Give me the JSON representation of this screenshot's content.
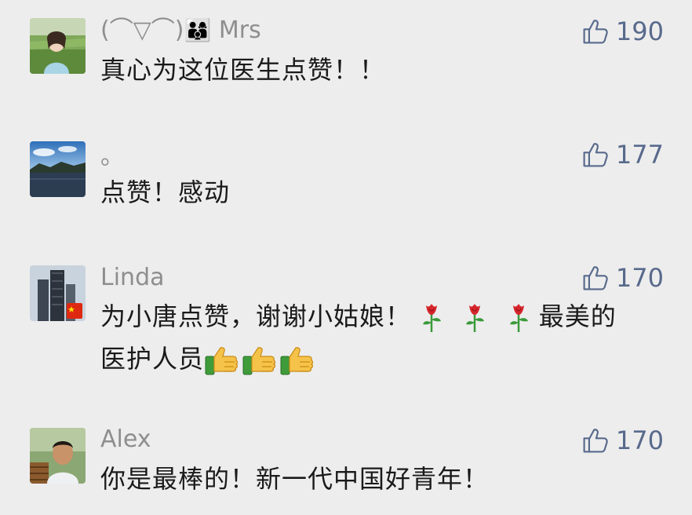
{
  "comments": [
    {
      "name": "(⌒▽⌒)",
      "name_emoji": "👨‍👩‍👦",
      "name_suffix": "Mrs",
      "likes": "190",
      "text": "真心为这位医生点赞！！"
    },
    {
      "name": "。",
      "likes": "177",
      "text": "点赞！感动"
    },
    {
      "name": "Linda",
      "likes": "170",
      "text_part1": "为小唐点赞，谢谢小姑娘！",
      "text_part2": "最美的",
      "text_part3": "医护人员"
    },
    {
      "name": "Alex",
      "likes": "170",
      "text": "你是最棒的！新一代中国好青年！"
    }
  ],
  "icons": {
    "like": "thumbs-up-outline-icon",
    "rose": "rose-emoji",
    "thumbs_up_emoji": "thumbs-up-emoji"
  },
  "colors": {
    "background": "#ededed",
    "name": "#8e8e8e",
    "like": "#586a8c",
    "text": "#1a1a1a"
  }
}
